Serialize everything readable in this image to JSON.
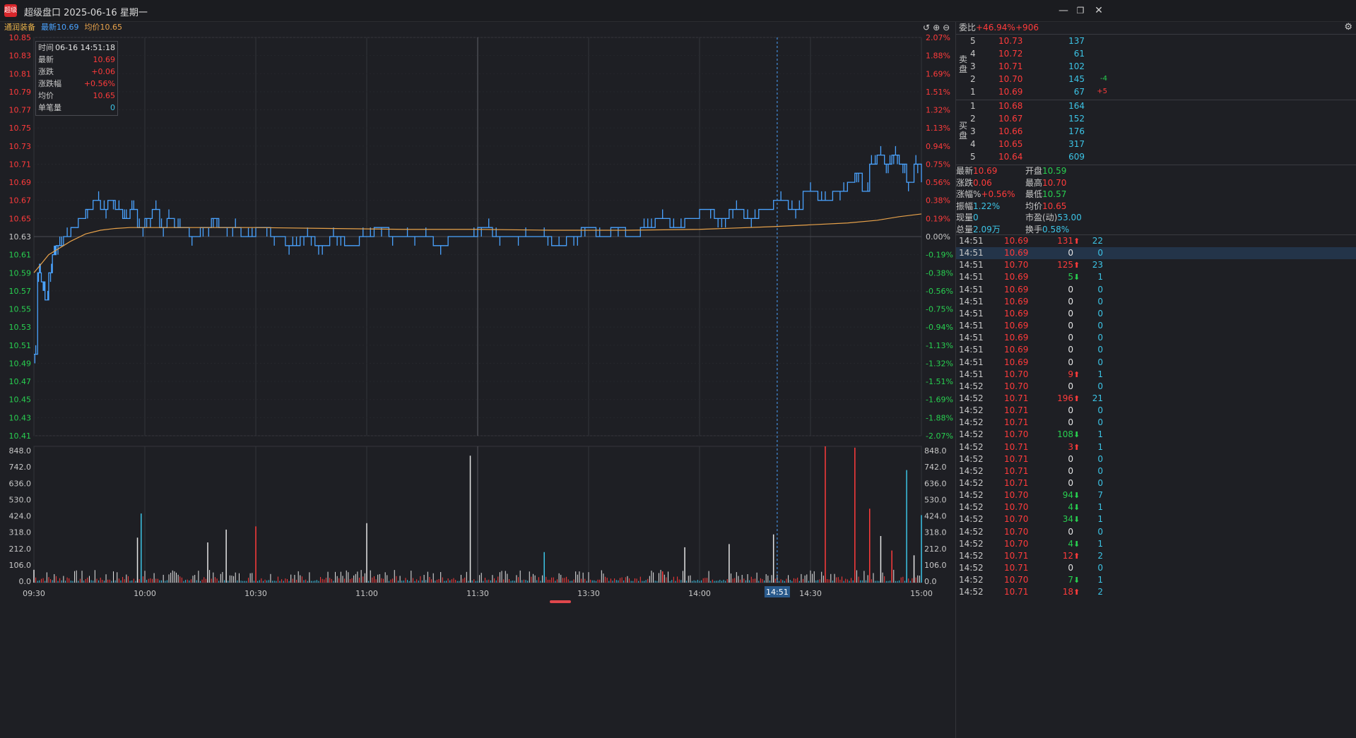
{
  "window": {
    "title": "超级盘口 2025-06-16 星期一",
    "app_icon_text": "超级",
    "controls": [
      "minimize",
      "restore",
      "close"
    ]
  },
  "info": {
    "stock_name": "通润装备",
    "latest_label": "最新",
    "latest_value": "10.69",
    "avg_label": "均价",
    "avg_value": "10.65"
  },
  "tooltip": {
    "rows": [
      {
        "k": "时间",
        "v": "06-16 14:51:18",
        "cls": "white"
      },
      {
        "k": "最新",
        "v": "10.69",
        "cls": "red"
      },
      {
        "k": "涨跌",
        "v": "+0.06",
        "cls": "red"
      },
      {
        "k": "涨跌幅",
        "v": "+0.56%",
        "cls": "red"
      },
      {
        "k": "均价",
        "v": "10.65",
        "cls": "red"
      },
      {
        "k": "单笔量",
        "v": "0",
        "cls": "cyan"
      }
    ]
  },
  "chart_data": {
    "type": "line",
    "price_axis_left": [
      "10.85",
      "10.83",
      "10.81",
      "10.79",
      "10.77",
      "10.75",
      "10.73",
      "10.71",
      "10.69",
      "10.67",
      "10.65",
      "10.63",
      "10.61",
      "10.59",
      "10.57",
      "10.55",
      "10.53",
      "10.51",
      "10.49",
      "10.47",
      "10.45",
      "10.43",
      "10.41"
    ],
    "pct_axis_right": [
      "2.07%",
      "1.88%",
      "1.69%",
      "1.51%",
      "1.32%",
      "1.13%",
      "0.94%",
      "0.75%",
      "0.56%",
      "0.38%",
      "0.19%",
      "0.00%",
      "-0.19%",
      "-0.38%",
      "-0.56%",
      "-0.75%",
      "-0.94%",
      "-1.13%",
      "-1.32%",
      "-1.51%",
      "-1.69%",
      "-1.88%",
      "-2.07%"
    ],
    "prev_close": 10.63,
    "ylim": [
      10.41,
      10.85
    ],
    "volume_axis": [
      "848.0",
      "742.0",
      "636.0",
      "530.0",
      "424.0",
      "318.0",
      "212.0",
      "106.0",
      "0.0"
    ],
    "volume_ylim": [
      0,
      848
    ],
    "time_ticks": [
      "09:30",
      "10:00",
      "10:30",
      "11:00",
      "11:30",
      "13:30",
      "14:00",
      "14:30",
      "15:00"
    ],
    "cursor_time": "14:51",
    "price_series": {
      "name": "最新",
      "x": [
        0,
        1,
        2,
        3,
        4,
        5,
        6,
        8,
        10,
        12,
        14,
        16,
        18,
        20,
        22,
        24,
        26,
        28,
        30,
        32,
        34,
        36,
        38,
        40,
        42,
        45,
        48,
        50,
        53,
        56,
        60,
        64,
        68,
        72,
        76,
        80,
        84,
        88,
        92,
        96,
        100,
        104,
        108,
        112,
        116,
        120,
        124,
        128,
        132,
        136,
        140,
        144,
        148,
        152,
        156,
        160,
        164,
        168,
        172,
        176,
        180,
        184,
        188,
        192,
        196,
        200,
        204,
        208,
        212,
        216,
        220,
        222,
        224,
        226,
        228,
        230,
        232,
        234,
        236,
        238,
        240
      ],
      "y": [
        10.5,
        10.59,
        10.58,
        10.56,
        10.59,
        10.61,
        10.62,
        10.63,
        10.64,
        10.65,
        10.66,
        10.67,
        10.66,
        10.67,
        10.66,
        10.65,
        10.66,
        10.64,
        10.65,
        10.66,
        10.64,
        10.65,
        10.64,
        10.64,
        10.63,
        10.64,
        10.65,
        10.64,
        10.64,
        10.63,
        10.64,
        10.63,
        10.62,
        10.63,
        10.62,
        10.63,
        10.62,
        10.63,
        10.64,
        10.63,
        10.63,
        10.63,
        10.62,
        10.63,
        10.63,
        10.64,
        10.63,
        10.63,
        10.63,
        10.63,
        10.62,
        10.63,
        10.64,
        10.63,
        10.64,
        10.63,
        10.64,
        10.65,
        10.64,
        10.65,
        10.66,
        10.65,
        10.66,
        10.65,
        10.66,
        10.67,
        10.66,
        10.68,
        10.67,
        10.68,
        10.69,
        10.7,
        10.68,
        10.71,
        10.72,
        10.71,
        10.72,
        10.71,
        10.69,
        10.71,
        10.69
      ]
    },
    "avg_series": {
      "name": "均价",
      "x": [
        0,
        2,
        4,
        6,
        8,
        10,
        14,
        18,
        22,
        26,
        30,
        40,
        60,
        80,
        100,
        120,
        140,
        160,
        180,
        200,
        210,
        220,
        228,
        234,
        240
      ],
      "y": [
        10.59,
        10.6,
        10.61,
        10.615,
        10.62,
        10.625,
        10.633,
        10.637,
        10.639,
        10.64,
        10.64,
        10.64,
        10.64,
        10.639,
        10.638,
        10.638,
        10.637,
        10.637,
        10.638,
        10.641,
        10.643,
        10.645,
        10.648,
        10.652,
        10.655
      ]
    },
    "volume_spikes": [
      {
        "x": 0,
        "v": 80,
        "c": "white"
      },
      {
        "x": 28,
        "v": 280,
        "c": "white"
      },
      {
        "x": 29,
        "v": 430,
        "c": "cyan"
      },
      {
        "x": 47,
        "v": 250,
        "c": "white"
      },
      {
        "x": 52,
        "v": 330,
        "c": "white"
      },
      {
        "x": 60,
        "v": 350,
        "c": "red"
      },
      {
        "x": 90,
        "v": 370,
        "c": "white"
      },
      {
        "x": 118,
        "v": 790,
        "c": "white"
      },
      {
        "x": 138,
        "v": 190,
        "c": "cyan"
      },
      {
        "x": 170,
        "v": 70,
        "c": "red"
      },
      {
        "x": 176,
        "v": 220,
        "c": "white"
      },
      {
        "x": 188,
        "v": 240,
        "c": "white"
      },
      {
        "x": 200,
        "v": 300,
        "c": "white"
      },
      {
        "x": 214,
        "v": 870,
        "c": "red"
      },
      {
        "x": 222,
        "v": 840,
        "c": "red"
      },
      {
        "x": 226,
        "v": 460,
        "c": "red"
      },
      {
        "x": 229,
        "v": 290,
        "c": "white"
      },
      {
        "x": 232,
        "v": 200,
        "c": "red"
      },
      {
        "x": 236,
        "v": 700,
        "c": "cyan"
      },
      {
        "x": 238,
        "v": 170,
        "c": "white"
      },
      {
        "x": 240,
        "v": 420,
        "c": "cyan"
      }
    ]
  },
  "panel": {
    "weibi_label": "委比",
    "weibi_value": "+46.94%",
    "weicha_value": "+906",
    "ask_label": "卖盘",
    "bid_label": "买盘",
    "asks": [
      {
        "lvl": "5",
        "price": "10.73",
        "vol": "137",
        "chg": ""
      },
      {
        "lvl": "4",
        "price": "10.72",
        "vol": "61",
        "chg": ""
      },
      {
        "lvl": "3",
        "price": "10.71",
        "vol": "102",
        "chg": ""
      },
      {
        "lvl": "2",
        "price": "10.70",
        "vol": "145",
        "chg": "-4",
        "chg_cls": "green"
      },
      {
        "lvl": "1",
        "price": "10.69",
        "vol": "67",
        "chg": "+5",
        "chg_cls": "red"
      }
    ],
    "bids": [
      {
        "lvl": "1",
        "price": "10.68",
        "vol": "164"
      },
      {
        "lvl": "2",
        "price": "10.67",
        "vol": "152"
      },
      {
        "lvl": "3",
        "price": "10.66",
        "vol": "176"
      },
      {
        "lvl": "4",
        "price": "10.65",
        "vol": "317"
      },
      {
        "lvl": "5",
        "price": "10.64",
        "vol": "609"
      }
    ],
    "stats": [
      {
        "k": "最新",
        "v": "10.69",
        "cls": "red"
      },
      {
        "k": "开盘",
        "v": "10.59",
        "cls": "green"
      },
      {
        "k": "涨跌",
        "v": "0.06",
        "cls": "red"
      },
      {
        "k": "最高",
        "v": "10.70",
        "cls": "red"
      },
      {
        "k": "涨幅%",
        "v": "+0.56%",
        "cls": "red"
      },
      {
        "k": "最低",
        "v": "10.57",
        "cls": "green"
      },
      {
        "k": "振幅",
        "v": "1.22%",
        "cls": "cyan"
      },
      {
        "k": "均价",
        "v": "10.65",
        "cls": "red"
      },
      {
        "k": "现量",
        "v": "0",
        "cls": "cyan"
      },
      {
        "k": "市盈(动)",
        "v": "53.00",
        "cls": "cyan"
      },
      {
        "k": "总量",
        "v": "2.09万",
        "cls": "cyan"
      },
      {
        "k": "换手",
        "v": "0.58%",
        "cls": "cyan"
      }
    ],
    "trades": [
      {
        "t": "14:51",
        "p": "10.69",
        "v": "131",
        "d": "up",
        "c": "22"
      },
      {
        "t": "14:51",
        "p": "10.69",
        "v": "0",
        "d": "",
        "c": "0",
        "sel": true
      },
      {
        "t": "14:51",
        "p": "10.70",
        "v": "125",
        "d": "up",
        "c": "23"
      },
      {
        "t": "14:51",
        "p": "10.69",
        "v": "5",
        "d": "down",
        "c": "1"
      },
      {
        "t": "14:51",
        "p": "10.69",
        "v": "0",
        "d": "",
        "c": "0"
      },
      {
        "t": "14:51",
        "p": "10.69",
        "v": "0",
        "d": "",
        "c": "0"
      },
      {
        "t": "14:51",
        "p": "10.69",
        "v": "0",
        "d": "",
        "c": "0"
      },
      {
        "t": "14:51",
        "p": "10.69",
        "v": "0",
        "d": "",
        "c": "0"
      },
      {
        "t": "14:51",
        "p": "10.69",
        "v": "0",
        "d": "",
        "c": "0"
      },
      {
        "t": "14:51",
        "p": "10.69",
        "v": "0",
        "d": "",
        "c": "0"
      },
      {
        "t": "14:51",
        "p": "10.69",
        "v": "0",
        "d": "",
        "c": "0"
      },
      {
        "t": "14:51",
        "p": "10.70",
        "v": "9",
        "d": "up",
        "c": "1"
      },
      {
        "t": "14:52",
        "p": "10.70",
        "v": "0",
        "d": "",
        "c": "0"
      },
      {
        "t": "14:52",
        "p": "10.71",
        "v": "196",
        "d": "up",
        "c": "21"
      },
      {
        "t": "14:52",
        "p": "10.71",
        "v": "0",
        "d": "",
        "c": "0"
      },
      {
        "t": "14:52",
        "p": "10.71",
        "v": "0",
        "d": "",
        "c": "0"
      },
      {
        "t": "14:52",
        "p": "10.70",
        "v": "108",
        "d": "down",
        "c": "1"
      },
      {
        "t": "14:52",
        "p": "10.71",
        "v": "3",
        "d": "up",
        "c": "1"
      },
      {
        "t": "14:52",
        "p": "10.71",
        "v": "0",
        "d": "",
        "c": "0"
      },
      {
        "t": "14:52",
        "p": "10.71",
        "v": "0",
        "d": "",
        "c": "0"
      },
      {
        "t": "14:52",
        "p": "10.71",
        "v": "0",
        "d": "",
        "c": "0"
      },
      {
        "t": "14:52",
        "p": "10.70",
        "v": "94",
        "d": "down",
        "c": "7"
      },
      {
        "t": "14:52",
        "p": "10.70",
        "v": "4",
        "d": "down",
        "c": "1"
      },
      {
        "t": "14:52",
        "p": "10.70",
        "v": "34",
        "d": "down",
        "c": "1"
      },
      {
        "t": "14:52",
        "p": "10.70",
        "v": "0",
        "d": "",
        "c": "0"
      },
      {
        "t": "14:52",
        "p": "10.70",
        "v": "4",
        "d": "down",
        "c": "1"
      },
      {
        "t": "14:52",
        "p": "10.71",
        "v": "12",
        "d": "up",
        "c": "2"
      },
      {
        "t": "14:52",
        "p": "10.71",
        "v": "0",
        "d": "",
        "c": "0"
      },
      {
        "t": "14:52",
        "p": "10.70",
        "v": "7",
        "d": "down",
        "c": "1"
      },
      {
        "t": "14:52",
        "p": "10.71",
        "v": "18",
        "d": "up",
        "c": "2"
      }
    ]
  }
}
